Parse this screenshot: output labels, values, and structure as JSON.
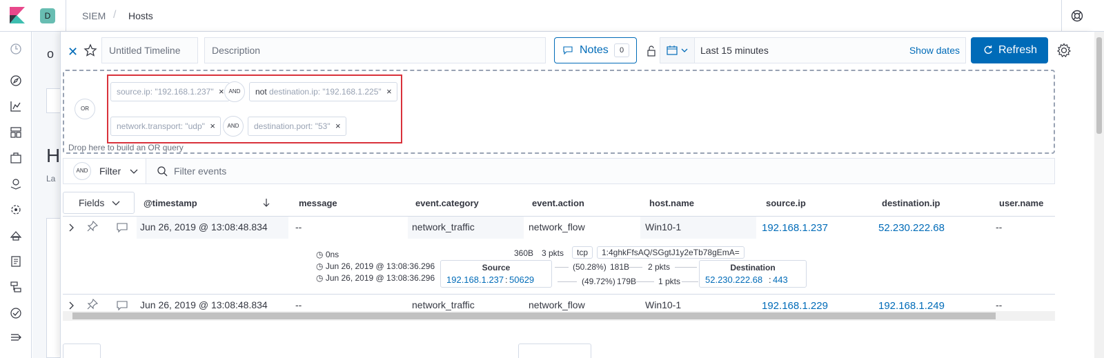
{
  "header": {
    "app_avatar": "D",
    "breadcrumb_app": "SIEM",
    "breadcrumb_sep": "/",
    "breadcrumb_page": "Hosts"
  },
  "background": {
    "letter_o": "o",
    "letter_h": "H",
    "letter_la": "La"
  },
  "timeline": {
    "title_placeholder": "Untitled Timeline",
    "description_placeholder": "Description",
    "notes_label": "Notes",
    "notes_count": "0",
    "date_range": "Last 15 minutes",
    "show_dates": "Show dates",
    "refresh_label": "Refresh"
  },
  "query": {
    "or_label": "OR",
    "and_label": "AND",
    "pills": [
      {
        "text": "source.ip: \"192.168.1.237\""
      },
      {
        "not": "not",
        "text": " destination.ip: \"192.168.1.225\""
      },
      {
        "text": "network.transport: \"udp\""
      },
      {
        "text": "destination.port: \"53\""
      }
    ],
    "close_glyph": "×",
    "drop_hint": "Drop here to build an OR query"
  },
  "filter": {
    "and_label": "AND",
    "label": "Filter",
    "placeholder": "Filter events"
  },
  "table": {
    "fields_label": "Fields",
    "columns": [
      "@timestamp",
      "message",
      "event.category",
      "event.action",
      "host.name",
      "source.ip",
      "destination.ip",
      "user.name"
    ],
    "rows": [
      {
        "timestamp": "Jun 26, 2019 @ 13:08:48.834",
        "message": "--",
        "category": "network_traffic",
        "action": "network_flow",
        "host": "Win10-1",
        "source_ip": "192.168.1.237",
        "dest_ip": "52.230.222.68",
        "user": "--"
      },
      {
        "timestamp": "Jun 26, 2019 @ 13:08:48.834",
        "message": "--",
        "category": "network_traffic",
        "action": "network_flow",
        "host": "Win10-1",
        "source_ip": "192.168.1.229",
        "dest_ip": "192.168.1.249",
        "user": "--"
      }
    ]
  },
  "flow": {
    "duration": "0ns",
    "start": "Jun 26, 2019 @ 13:08:36.296",
    "end": "Jun 26, 2019 @ 13:08:36.296",
    "bytes": "360B",
    "packets": "3 pkts",
    "transport": "tcp",
    "community_id": "1:4ghkFfsAQ/SGgtJ1y2eTb78gEmA=",
    "source_title": "Source",
    "source_ip": "192.168.1.237",
    "source_port": "50629",
    "dest_title": "Destination",
    "dest_ip": "52.230.222.68",
    "dest_port": "443",
    "out_pct": "(50.28%)",
    "out_bytes": "181B",
    "out_pkts": "2 pkts",
    "in_pct": "(49.72%)",
    "in_bytes": "179B",
    "in_pkts": "1 pkts",
    "colon": ":"
  },
  "icons": [
    "kibana-logo-icon",
    "clock-icon",
    "compass-icon",
    "visualize-icon",
    "dashboard-icon",
    "canvas-icon",
    "maps-icon",
    "ml-icon",
    "infra-icon",
    "logs-icon",
    "apm-icon",
    "uptime-icon",
    "collapse-icon",
    "help-icon",
    "close-icon",
    "star-icon",
    "lock-icon",
    "calendar-icon",
    "refresh-icon",
    "gear-icon",
    "search-icon",
    "expand-icon",
    "pin-icon",
    "note-icon"
  ],
  "colors": {
    "accent": "#006bb8",
    "highlight": "#d9313a",
    "logo_pink": "#e8488b",
    "logo_teal": "#3ebeb0"
  }
}
